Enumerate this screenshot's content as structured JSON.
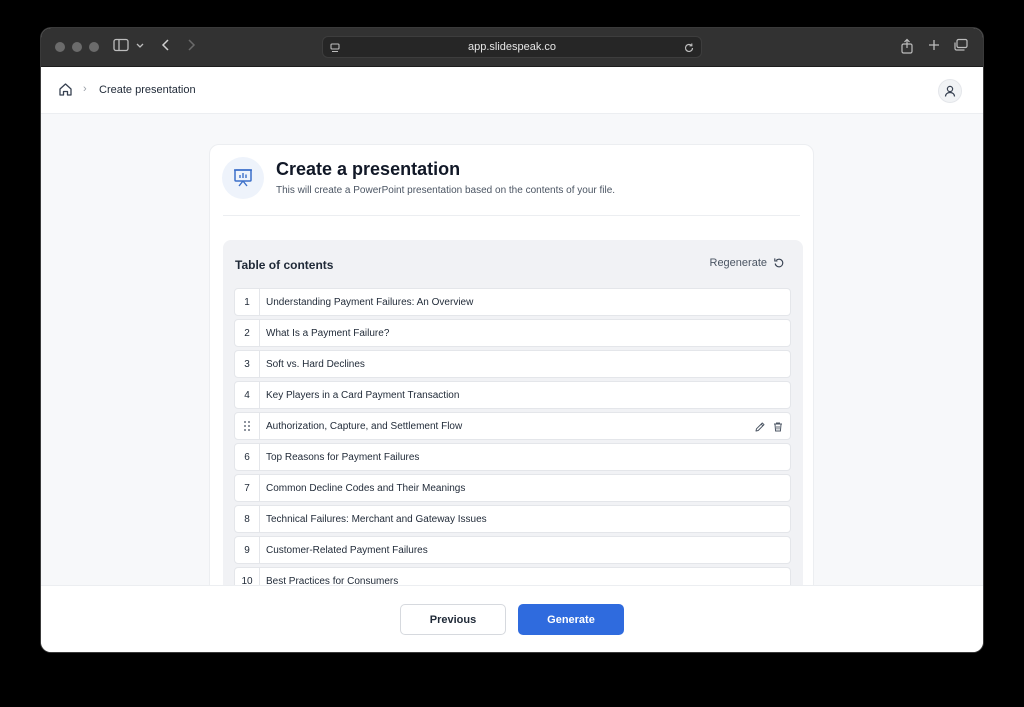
{
  "browser": {
    "url": "app.slidespeak.co"
  },
  "breadcrumb": {
    "separator": "›",
    "current": "Create presentation"
  },
  "card": {
    "title": "Create a presentation",
    "subtitle": "This will create a PowerPoint presentation based on the contents of your file."
  },
  "toc": {
    "title": "Table of contents",
    "regenerate_label": "Regenerate",
    "items": [
      {
        "num": "1",
        "text": "Understanding Payment Failures: An Overview"
      },
      {
        "num": "2",
        "text": "What Is a Payment Failure?"
      },
      {
        "num": "3",
        "text": "Soft vs. Hard Declines"
      },
      {
        "num": "4",
        "text": "Key Players in a Card Payment Transaction"
      },
      {
        "num": "",
        "text": "Authorization, Capture, and Settlement Flow"
      },
      {
        "num": "6",
        "text": "Top Reasons for Payment Failures"
      },
      {
        "num": "7",
        "text": "Common Decline Codes and Their Meanings"
      },
      {
        "num": "8",
        "text": "Technical Failures: Merchant and Gateway Issues"
      },
      {
        "num": "9",
        "text": "Customer-Related Payment Failures"
      },
      {
        "num": "10",
        "text": "Best Practices for Consumers"
      }
    ]
  },
  "footer": {
    "previous_label": "Previous",
    "generate_label": "Generate"
  },
  "colors": {
    "accent": "#2f6bde",
    "icon_blue": "#3b6fc9"
  }
}
